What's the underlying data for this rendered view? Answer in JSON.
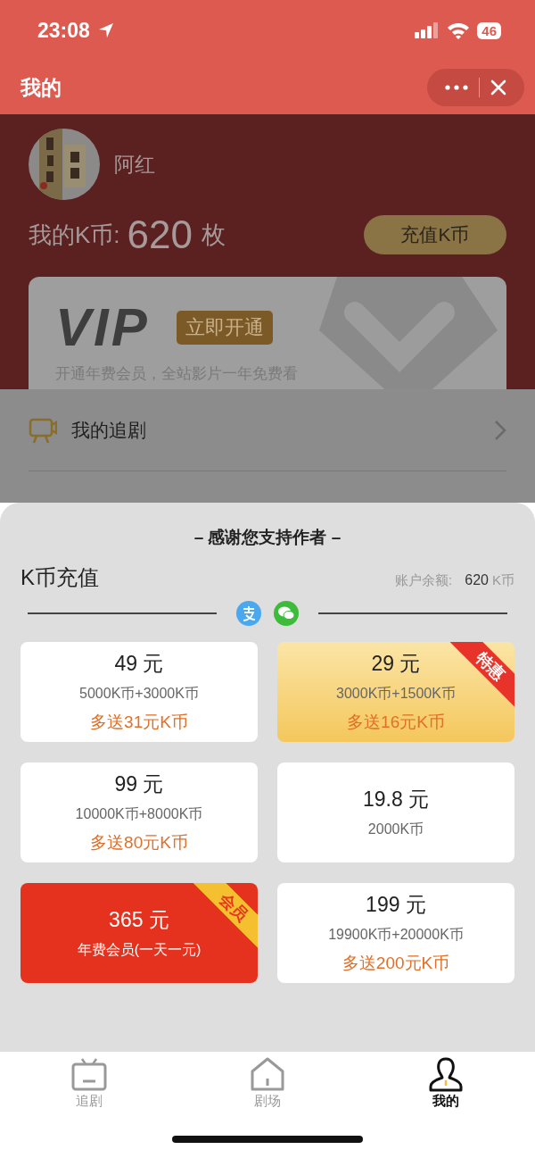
{
  "status_bar": {
    "time": "23:08",
    "battery": "46"
  },
  "nav": {
    "title": "我的"
  },
  "profile": {
    "name": "阿红",
    "coins_label": "我的K币:",
    "coins": "620",
    "coins_unit": "枚",
    "recharge_button": "充值K币"
  },
  "vip_banner": {
    "title": "VIP",
    "button": "立即开通",
    "subtitle": "开通年费会员，全站影片一年免费看"
  },
  "menu": [
    {
      "label": "我的追剧"
    }
  ],
  "sheet": {
    "heading": "– 感谢您支持作者 –",
    "title": "K币充值",
    "balance_label": "账户余额:",
    "balance": "620",
    "balance_unit": "K币",
    "packages": [
      {
        "kind": "regular",
        "price": "49 元",
        "coins": "5000K币+3000K币",
        "bonus": "多送31元K币"
      },
      {
        "kind": "featured",
        "price": "29 元",
        "coins": "3000K币+1500K币",
        "bonus": "多送16元K币",
        "ribbon": "特惠"
      },
      {
        "kind": "regular",
        "price": "99 元",
        "coins": "10000K币+8000K币",
        "bonus": "多送80元K币"
      },
      {
        "kind": "regular",
        "price": "19.8 元",
        "coins": "2000K币"
      },
      {
        "kind": "member",
        "price": "365 元",
        "coins": "年费会员(一天一元)",
        "ribbon": "会员"
      },
      {
        "kind": "regular",
        "price": "199 元",
        "coins": "19900K币+20000K币",
        "bonus": "多送200元K币"
      }
    ]
  },
  "tabs": [
    {
      "kind": "tv",
      "label": "追剧",
      "selected": false
    },
    {
      "kind": "home",
      "label": "剧场",
      "selected": false
    },
    {
      "kind": "user",
      "label": "我的",
      "selected": true
    }
  ]
}
